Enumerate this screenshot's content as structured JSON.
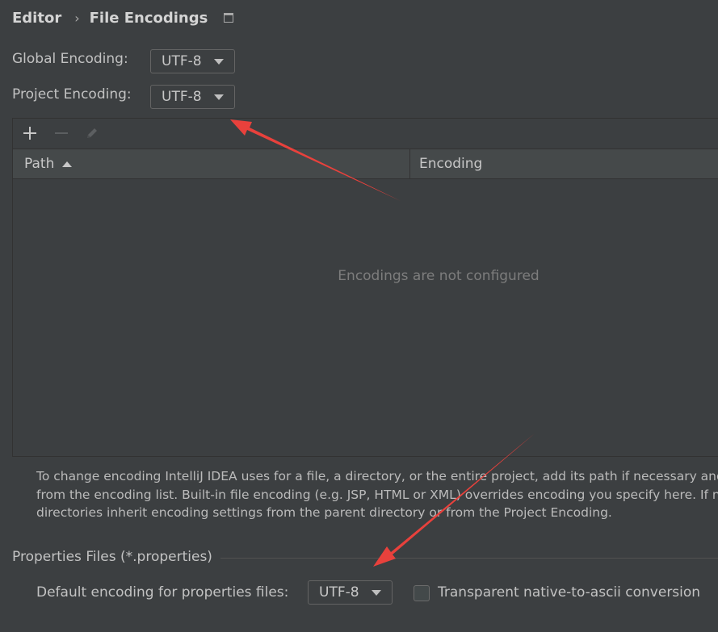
{
  "breadcrumb": {
    "parent": "Editor",
    "separator": "›",
    "current": "File Encodings"
  },
  "global_encoding": {
    "label": "Global Encoding:",
    "value": "UTF-8"
  },
  "project_encoding": {
    "label": "Project Encoding:",
    "value": "UTF-8"
  },
  "table": {
    "columns": [
      "Path",
      "Encoding"
    ],
    "sort_column": "Path",
    "sort_direction": "ascending",
    "empty_text": "Encodings are not configured",
    "toolbar": {
      "add_icon": "plus-icon",
      "remove_icon": "minus-icon",
      "edit_icon": "pencil-icon"
    }
  },
  "help_lines": [
    "To change encoding IntelliJ IDEA uses for a file, a directory, or the entire project, add its path if necessary and t",
    "from the encoding list. Built-in file encoding (e.g. JSP, HTML or XML) overrides encoding you specify here. If no",
    "directories inherit encoding settings from the parent directory or from the Project Encoding."
  ],
  "properties": {
    "section_title": "Properties Files (*.properties)",
    "default_label": "Default encoding for properties files:",
    "default_value": "UTF-8",
    "checkbox_label": "Transparent native-to-ascii conversion",
    "checkbox_checked": false
  },
  "colors": {
    "background": "#3c3f41",
    "annotation_arrow": "#e8413c"
  }
}
